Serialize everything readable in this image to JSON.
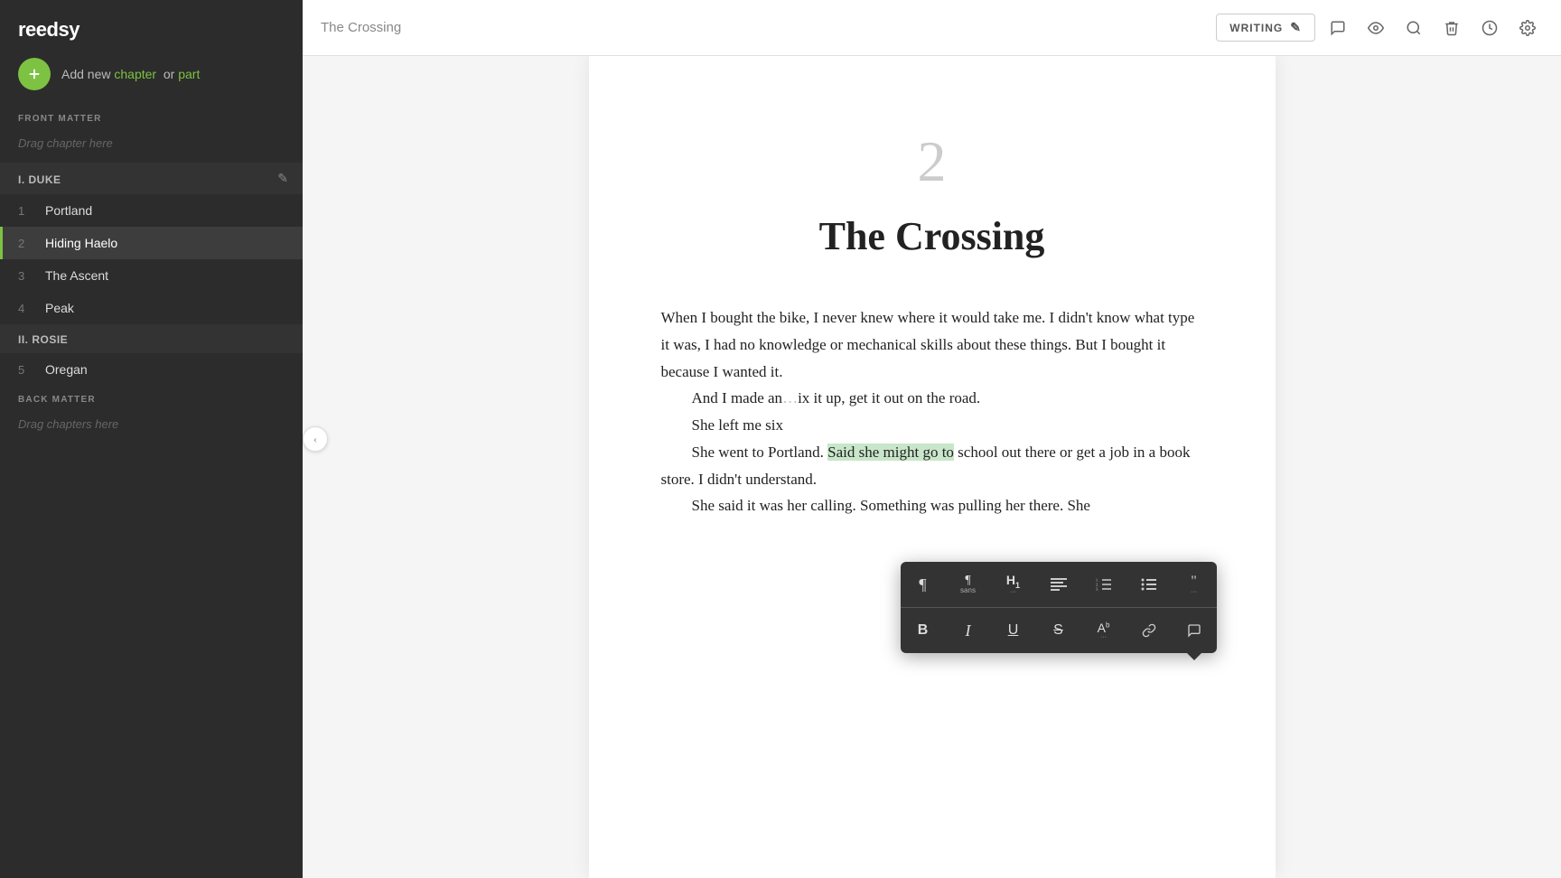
{
  "app": {
    "logo": "reedsy",
    "add_label": "Add new",
    "add_chapter_link": "chapter",
    "add_or": "or",
    "add_part_link": "part"
  },
  "sidebar": {
    "front_matter_label": "FRONT MATTER",
    "front_matter_drag": "Drag chapter here",
    "back_matter_label": "BACK MATTER",
    "back_matter_drag": "Drag chapters here",
    "parts": [
      {
        "id": "I",
        "label": "I. DUKE",
        "chapters": [
          {
            "num": 1,
            "title": "Portland",
            "active": false
          },
          {
            "num": 2,
            "title": "Hiding Haelo",
            "active": true
          },
          {
            "num": 3,
            "title": "The Ascent",
            "active": false
          },
          {
            "num": 4,
            "title": "Peak",
            "active": false
          }
        ]
      },
      {
        "id": "II",
        "label": "II. ROSIE",
        "chapters": [
          {
            "num": 5,
            "title": "Oregan",
            "active": false
          }
        ]
      }
    ]
  },
  "topbar": {
    "doc_title": "The Crossing",
    "mode_label": "WRITING",
    "icons": [
      "comment",
      "preview",
      "search",
      "delete",
      "history",
      "settings"
    ]
  },
  "document": {
    "chapter_number": "2",
    "chapter_title": "The Crossing",
    "paragraphs": [
      {
        "indent": false,
        "text": "When I bought the bike, I never knew where it would take me. I didn't know what type it was, I had no knowledge or mechanical skills about these things. But I bought it because I wanted it."
      },
      {
        "indent": true,
        "text": "And I made an",
        "suffix": "ix it up, get it out on the road."
      },
      {
        "indent": true,
        "text": "She left me six"
      },
      {
        "indent": true,
        "text": "She went to Portland. ",
        "highlighted": "Said she might go to",
        "suffix": " school out there or get a job in a book store. I didn't understand."
      },
      {
        "indent": true,
        "text": "She said it was her calling. Something was pulling her there. She"
      }
    ]
  },
  "toolbar": {
    "row1": [
      {
        "icon": "paragraph",
        "label": "¶",
        "tooltip": "Paragraph"
      },
      {
        "icon": "paragraph-sans",
        "label": "¶",
        "sub": "sans",
        "tooltip": "Paragraph Sans"
      },
      {
        "icon": "heading1",
        "label": "H1",
        "tooltip": "Heading 1"
      },
      {
        "icon": "align",
        "label": "align",
        "tooltip": "Alignment"
      },
      {
        "icon": "ordered-list",
        "label": "ol",
        "tooltip": "Ordered List"
      },
      {
        "icon": "unordered-list",
        "label": "ul",
        "tooltip": "Unordered List"
      },
      {
        "icon": "blockquote",
        "label": "\"\"",
        "tooltip": "Blockquote"
      }
    ],
    "row2": [
      {
        "icon": "bold",
        "label": "B",
        "tooltip": "Bold"
      },
      {
        "icon": "italic",
        "label": "I",
        "tooltip": "Italic"
      },
      {
        "icon": "underline",
        "label": "U",
        "tooltip": "Underline"
      },
      {
        "icon": "strikethrough",
        "label": "S",
        "tooltip": "Strikethrough"
      },
      {
        "icon": "superscript",
        "label": "Aᵇ",
        "tooltip": "Superscript"
      },
      {
        "icon": "link",
        "label": "🔗",
        "tooltip": "Link"
      },
      {
        "icon": "comment",
        "label": "💬",
        "tooltip": "Comment"
      }
    ]
  }
}
